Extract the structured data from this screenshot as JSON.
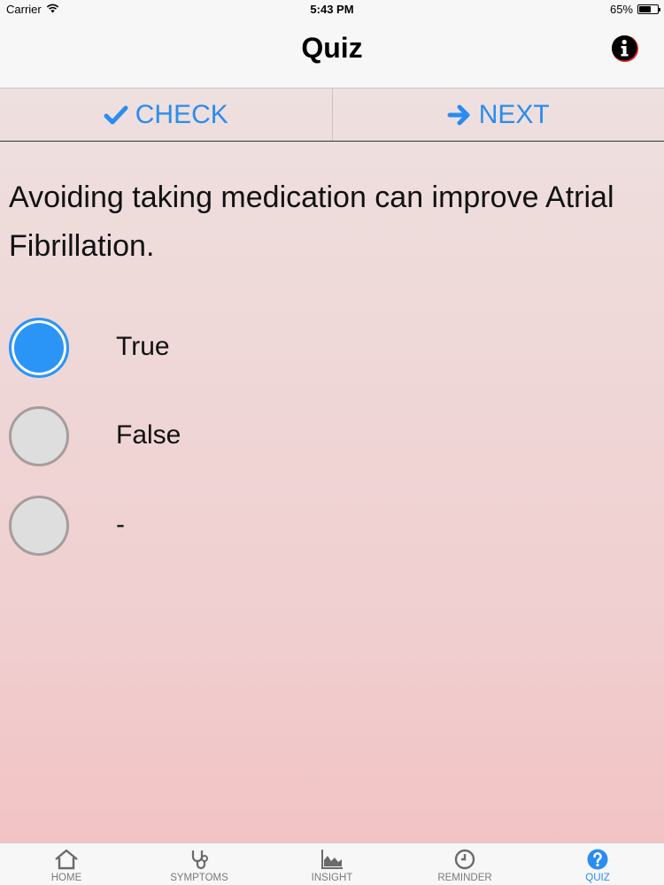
{
  "status_bar": {
    "carrier": "Carrier",
    "time": "5:43 PM",
    "battery_percent": "65%",
    "battery_level": 0.65
  },
  "nav": {
    "title": "Quiz",
    "info_icon": "info-icon"
  },
  "toolbar": {
    "check_label": "CHECK",
    "next_label": "NEXT",
    "check_icon": "checkmark-icon",
    "next_icon": "arrow-right-icon"
  },
  "question": {
    "text": "Avoiding taking medication can improve Atrial Fibrillation."
  },
  "options": [
    {
      "label": "True",
      "selected": true
    },
    {
      "label": "False",
      "selected": false
    },
    {
      "label": "-",
      "selected": false
    }
  ],
  "tabs": [
    {
      "label": "HOME",
      "icon": "home-icon",
      "active": false
    },
    {
      "label": "SYMPTOMS",
      "icon": "stethoscope-icon",
      "active": false
    },
    {
      "label": "INSIGHT",
      "icon": "chart-icon",
      "active": false
    },
    {
      "label": "REMINDER",
      "icon": "clock-icon",
      "active": false
    },
    {
      "label": "QUIZ",
      "icon": "question-icon",
      "active": true
    }
  ],
  "colors": {
    "accent": "#2a8cef",
    "selected_radio": "#2a95f7",
    "unselected_radio": "#dedede",
    "info_icon_ring": "#e02020"
  }
}
